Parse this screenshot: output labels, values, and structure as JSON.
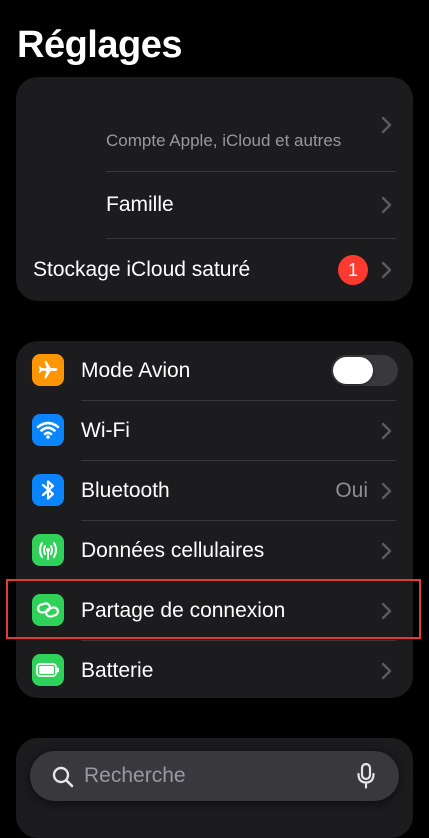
{
  "page": {
    "title": "Réglages"
  },
  "account": {
    "profile_subtitle": "Compte Apple, iCloud et autres",
    "family_label": "Famille",
    "storage_label": "Stockage iCloud saturé",
    "storage_badge": "1"
  },
  "network": {
    "airplane": {
      "label": "Mode Avion",
      "icon": "airplane-icon",
      "color": "#ff9500",
      "toggle_on": false
    },
    "wifi": {
      "label": "Wi-Fi",
      "icon": "wifi-icon",
      "color": "#0a84ff"
    },
    "bluetooth": {
      "label": "Bluetooth",
      "value": "Oui",
      "icon": "bluetooth-icon",
      "color": "#0a84ff"
    },
    "cellular": {
      "label": "Données cellulaires",
      "icon": "antenna-icon",
      "color": "#30d158"
    },
    "hotspot": {
      "label": "Partage de connexion",
      "icon": "chain-link-icon",
      "color": "#30d158",
      "highlighted": true
    },
    "battery": {
      "label": "Batterie",
      "icon": "battery-icon",
      "color": "#30d158"
    }
  },
  "search": {
    "placeholder": "Recherche"
  },
  "colors": {
    "background": "#000000",
    "group": "#1c1c1e",
    "separator": "#38383a",
    "secondary_text": "#98989f",
    "badge": "#ff3b30",
    "highlight": "#e03a3a"
  }
}
